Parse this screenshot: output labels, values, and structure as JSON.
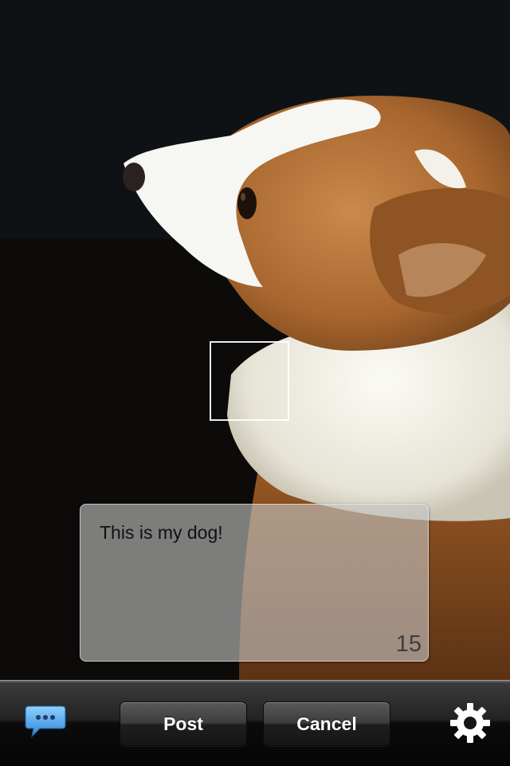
{
  "caption": {
    "text": "This is my dog!",
    "char_count": "15"
  },
  "toolbar": {
    "post_label": "Post",
    "cancel_label": "Cancel",
    "chat_icon": "chat-bubble-icon",
    "settings_icon": "gear-icon"
  },
  "colors": {
    "toolbar_bg": "#1a1a1a",
    "chat_icon": "#3fa0e8",
    "caption_bg": "#c4c4c4"
  }
}
